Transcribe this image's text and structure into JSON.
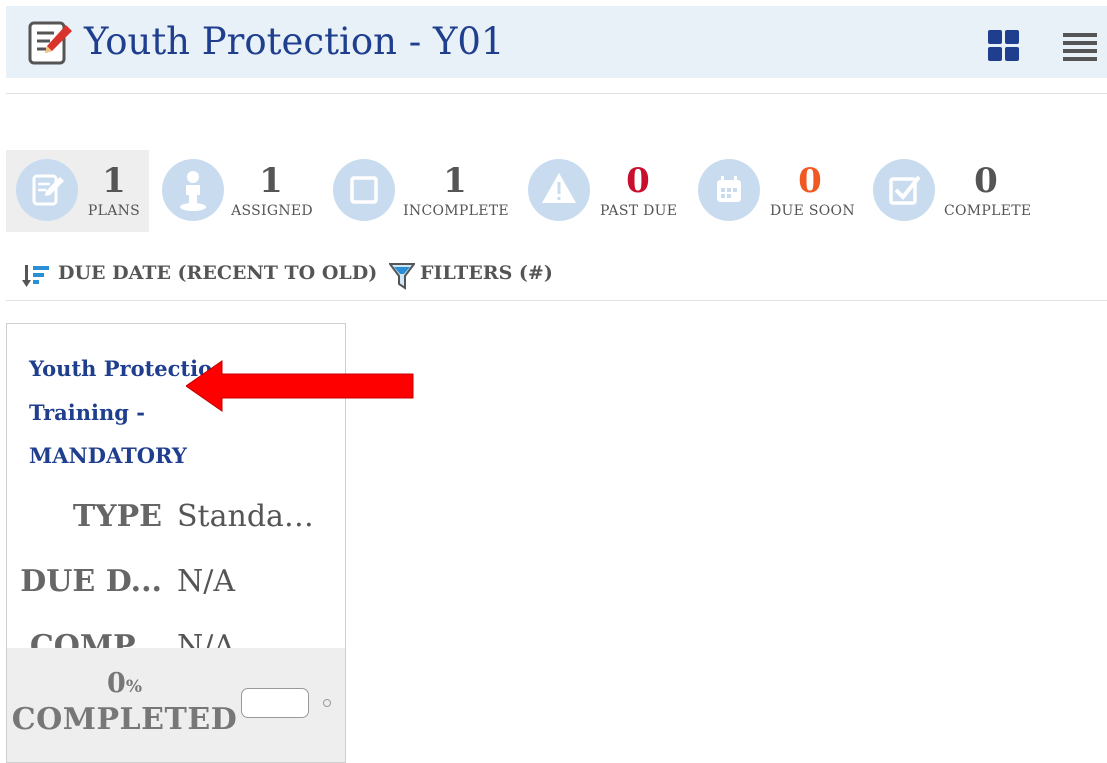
{
  "header": {
    "title": "Youth Protection - Y01",
    "icon": "edit-document-icon",
    "view_toggle_icon": "grid-view-icon",
    "menu_icon": "hamburger-menu-icon"
  },
  "stats": [
    {
      "name": "plans",
      "count": "1",
      "label": "PLANS",
      "icon": "document-edit-icon",
      "count_color": "#555555"
    },
    {
      "name": "assigned",
      "count": "1",
      "label": "ASSIGNED",
      "icon": "person-icon",
      "count_color": "#555555"
    },
    {
      "name": "incomplete",
      "count": "1",
      "label": "INCOMPLETE",
      "icon": "square-icon",
      "count_color": "#555555"
    },
    {
      "name": "past-due",
      "count": "0",
      "label": "PAST DUE",
      "icon": "warning-icon",
      "count_color": "#c8102e"
    },
    {
      "name": "due-soon",
      "count": "0",
      "label": "DUE SOON",
      "icon": "calendar-icon",
      "count_color": "#f05a22"
    },
    {
      "name": "complete",
      "count": "0",
      "label": "COMPLETE",
      "icon": "checkbox-checked-icon",
      "count_color": "#555555"
    }
  ],
  "sort": {
    "label": "DUE DATE (RECENT TO OLD)",
    "icon": "sort-descending-icon"
  },
  "filter": {
    "label": "FILTERS (#)",
    "icon": "funnel-icon"
  },
  "card": {
    "title_lines": [
      "Youth Protectio",
      "Training -",
      "MANDATORY"
    ],
    "rows": [
      {
        "label": "TYPE",
        "value": "Standar..."
      },
      {
        "label": "DUE D...",
        "value": "N/A"
      },
      {
        "label": "COMP...",
        "value": "N/A"
      }
    ],
    "percent": "0",
    "percent_unit": "%",
    "completed_label": "COMPLETED"
  },
  "colors": {
    "brand_blue": "#1f3f8e",
    "icon_circle": "#c9dcef",
    "annotation_arrow": "#ff0000"
  },
  "annotation": {
    "icon": "red-arrow-pointing-left"
  }
}
